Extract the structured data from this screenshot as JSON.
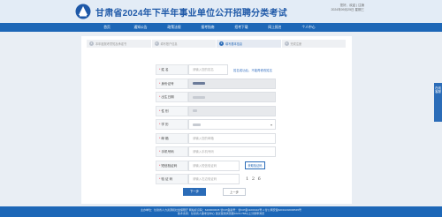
{
  "header": {
    "title": "甘肃省2024年下半年事业单位公开招聘分类考试",
    "user_line1": "您好，欢迎 | 注销",
    "user_line2": "2024年09月25日 星期三"
  },
  "nav": [
    {
      "label": "首页"
    },
    {
      "label": "通知公告"
    },
    {
      "label": "政策法规"
    },
    {
      "label": "报考指南"
    },
    {
      "label": "招考下载"
    },
    {
      "label": "网上报名"
    },
    {
      "label": "个人中心"
    }
  ],
  "steps": [
    {
      "num": "1",
      "label": "本年度报考须知及承诺书",
      "active": false
    },
    {
      "num": "2",
      "label": "填写账户信息",
      "active": false
    },
    {
      "num": "3",
      "label": "填写基本信息",
      "active": true
    },
    {
      "num": "4",
      "label": "完成注册",
      "active": false
    }
  ],
  "form": {
    "name": {
      "label": "姓    名",
      "placeholder": "请输入您的姓名",
      "tip": "姓名成功后，不能再修改姓名"
    },
    "id": {
      "label": "身份证号"
    },
    "birth": {
      "label": "出生日期"
    },
    "gender": {
      "label": "性    别"
    },
    "edu": {
      "label": "学    历",
      "caret": "▾"
    },
    "email": {
      "label": "邮    箱",
      "placeholder": "请输入您的邮箱"
    },
    "phone": {
      "label": "手机号码",
      "placeholder": "请输入手机号码"
    },
    "sms": {
      "label": "短信验证码",
      "placeholder": "请输入短信验证码",
      "button": "获取验证码"
    },
    "captcha": {
      "label": "验 证 码",
      "placeholder": "请输入右边验证码",
      "image_text": "1 2 6"
    },
    "next_button": "下一步",
    "prev_button": "上一步"
  },
  "side_tab": {
    "label": "在线客服"
  },
  "footer": {
    "line1": "主办单位：甘肃省人力资源和社会保障厅    网站标识码：6200000045    甘ICP备案号：甘ICP备11000110号-1    甘公网安备62010202000545号",
    "line2": "技术支持：甘肃省人事考试中心    建议使用浏览器1024×768以上分辨率浏览"
  }
}
